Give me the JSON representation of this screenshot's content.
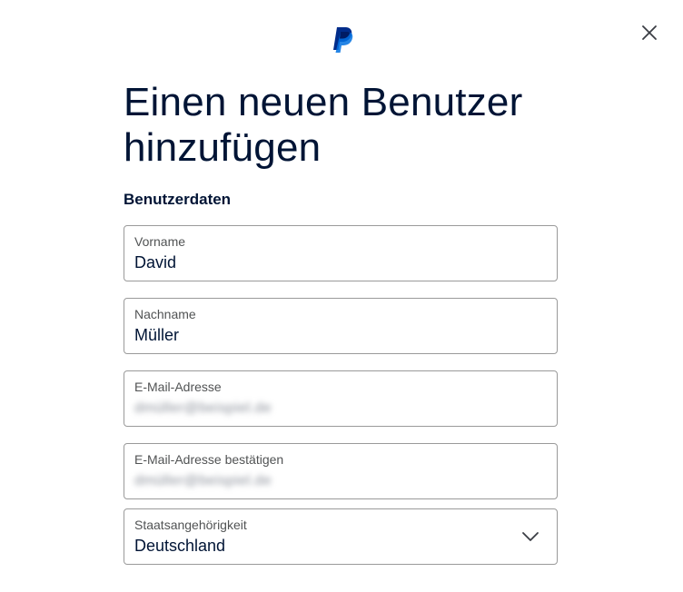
{
  "header": {
    "logo_icon": "paypal-logo",
    "close_icon": "close-icon"
  },
  "title": "Einen neuen Benutzer hinzufügen",
  "section": {
    "heading": "Benutzerdaten"
  },
  "fields": {
    "first_name": {
      "label": "Vorname",
      "value": "David"
    },
    "last_name": {
      "label": "Nachname",
      "value": "Müller"
    },
    "email": {
      "label": "E-Mail-Adresse",
      "value": "dmüller@beispiel.de"
    },
    "email_confirm": {
      "label": "E-Mail-Adresse bestätigen",
      "value": "dmüller@beispiel.de"
    },
    "nationality": {
      "label": "Staatsangehörigkeit",
      "value": "Deutschland",
      "icon": "chevron-down-icon"
    }
  },
  "colors": {
    "text_primary": "#001435",
    "label": "#515354",
    "border": "#9a9a9a",
    "paypal_dark": "#002c8a",
    "paypal_light": "#009be1"
  }
}
